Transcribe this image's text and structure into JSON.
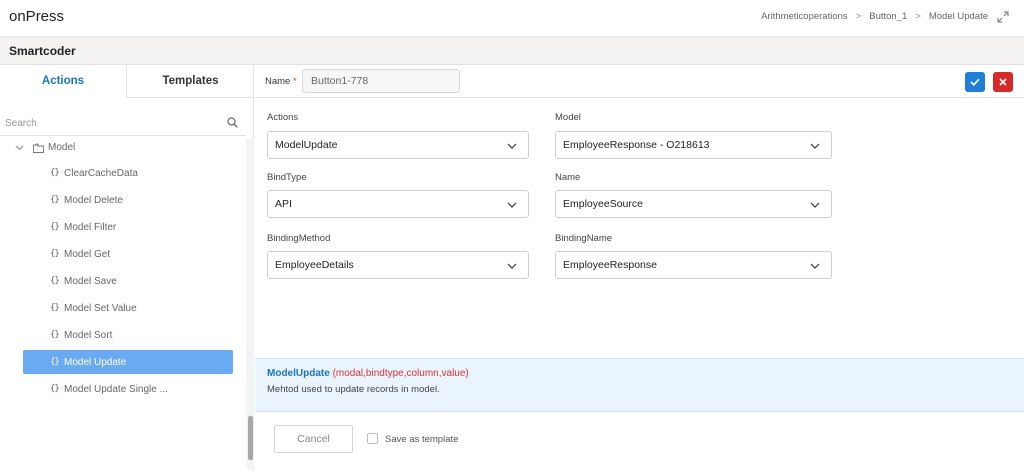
{
  "header": {
    "app_title": "onPress",
    "breadcrumb": [
      "Arithmeticoperations",
      "Button_1",
      "Model Update"
    ],
    "breadcrumb_separator": ">"
  },
  "subheader": {
    "title": "Smartcoder"
  },
  "sidebar": {
    "tabs": [
      {
        "label": "Actions",
        "active": true
      },
      {
        "label": "Templates",
        "active": false
      }
    ],
    "search": {
      "placeholder": "Search",
      "value": ""
    },
    "tree": {
      "root_label": "Model",
      "items": [
        {
          "label": "ClearCacheData",
          "active": false
        },
        {
          "label": "Model Delete",
          "active": false
        },
        {
          "label": "Model Filter",
          "active": false
        },
        {
          "label": "Model Get",
          "active": false
        },
        {
          "label": "Model Save",
          "active": false
        },
        {
          "label": "Model Set Value",
          "active": false
        },
        {
          "label": "Model Sort",
          "active": false
        },
        {
          "label": "Model Update",
          "active": true
        },
        {
          "label": "Model Update Single ...",
          "active": false
        }
      ],
      "item_prefix": "{}"
    }
  },
  "main": {
    "name_label": "Name",
    "required_mark": "*",
    "name_value": "Button1-778",
    "fields": {
      "actions": {
        "label": "Actions",
        "value": "ModelUpdate"
      },
      "model": {
        "label": "Model",
        "value": "EmployeeResponse - O218613"
      },
      "bindtype": {
        "label": "BindType",
        "value": "API"
      },
      "name": {
        "label": "Name",
        "value": "EmployeeSource"
      },
      "bindingmethod": {
        "label": "BindingMethod",
        "value": "EmployeeDetails"
      },
      "bindingname": {
        "label": "BindingName",
        "value": "EmployeeResponse"
      }
    },
    "info": {
      "function": "ModelUpdate",
      "params": "(modal,bindtype,column,value)",
      "description": "Mehtod used to update records in model."
    },
    "footer": {
      "cancel_label": "Cancel",
      "save_template_label": "Save as template",
      "save_template_checked": false
    }
  },
  "colors": {
    "accent": "#1a73c8",
    "active_item_bg": "#6aaaf2",
    "confirm_button": "#1f7fd6",
    "close_button": "#d42a2a",
    "info_bg": "#eaf4fc",
    "params_red": "#e0303a"
  },
  "icons": {
    "expand": "expand-arrows-icon",
    "search": "search-icon",
    "tree_chevron": "chevron-down-icon",
    "tree_folder": "folder-icon",
    "dropdown": "chevron-down-icon",
    "confirm": "check-icon",
    "close": "close-icon"
  }
}
